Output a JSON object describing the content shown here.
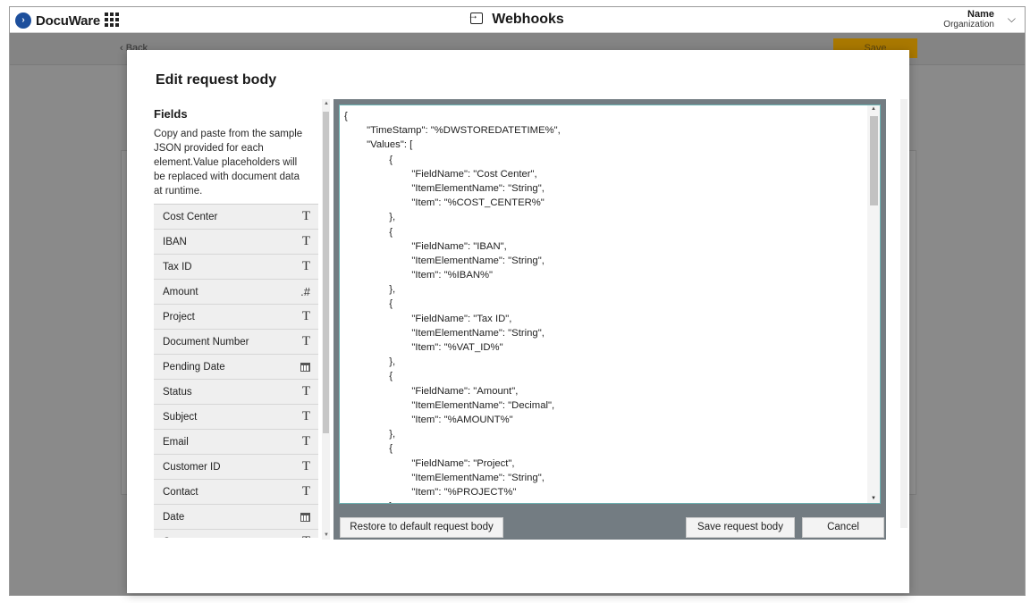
{
  "app": {
    "logo_text": "DocuWare",
    "title": "Webhooks",
    "user_name": "Name",
    "user_org": "Organization"
  },
  "background": {
    "back_label": "‹ Back",
    "save_label": "Save"
  },
  "modal": {
    "title": "Edit request body",
    "fields_heading": "Fields",
    "fields_description": "Copy and paste from the sample JSON provided for each element.Value placeholders will be replaced with document data at runtime.",
    "fields": [
      {
        "name": "Cost Center",
        "type": "T"
      },
      {
        "name": "IBAN",
        "type": "T"
      },
      {
        "name": "Tax ID",
        "type": "T"
      },
      {
        "name": "Amount",
        "type": ".#"
      },
      {
        "name": "Project",
        "type": "T"
      },
      {
        "name": "Document Number",
        "type": "T"
      },
      {
        "name": "Pending Date",
        "type": "calendar"
      },
      {
        "name": "Status",
        "type": "T"
      },
      {
        "name": "Subject",
        "type": "T"
      },
      {
        "name": "Email",
        "type": "T"
      },
      {
        "name": "Customer ID",
        "type": "T"
      },
      {
        "name": "Contact",
        "type": "T"
      },
      {
        "name": "Date",
        "type": "calendar"
      },
      {
        "name": "Company",
        "type": "T"
      }
    ],
    "request_body_lines": [
      "{",
      "        \"TimeStamp\": \"%DWSTOREDATETIME%\",",
      "        \"Values\": [",
      "                {",
      "                        \"FieldName\": \"Cost Center\",",
      "                        \"ItemElementName\": \"String\",",
      "                        \"Item\": \"%COST_CENTER%\"",
      "                },",
      "                {",
      "                        \"FieldName\": \"IBAN\",",
      "                        \"ItemElementName\": \"String\",",
      "                        \"Item\": \"%IBAN%\"",
      "                },",
      "                {",
      "                        \"FieldName\": \"Tax ID\",",
      "                        \"ItemElementName\": \"String\",",
      "                        \"Item\": \"%VAT_ID%\"",
      "                },",
      "                {",
      "                        \"FieldName\": \"Amount\",",
      "                        \"ItemElementName\": \"Decimal\",",
      "                        \"Item\": \"%AMOUNT%\"",
      "                },",
      "                {",
      "                        \"FieldName\": \"Project\",",
      "                        \"ItemElementName\": \"String\",",
      "                        \"Item\": \"%PROJECT%\"",
      "                },"
    ],
    "restore_label": "Restore to default request body",
    "save_label": "Save request body",
    "cancel_label": "Cancel"
  }
}
